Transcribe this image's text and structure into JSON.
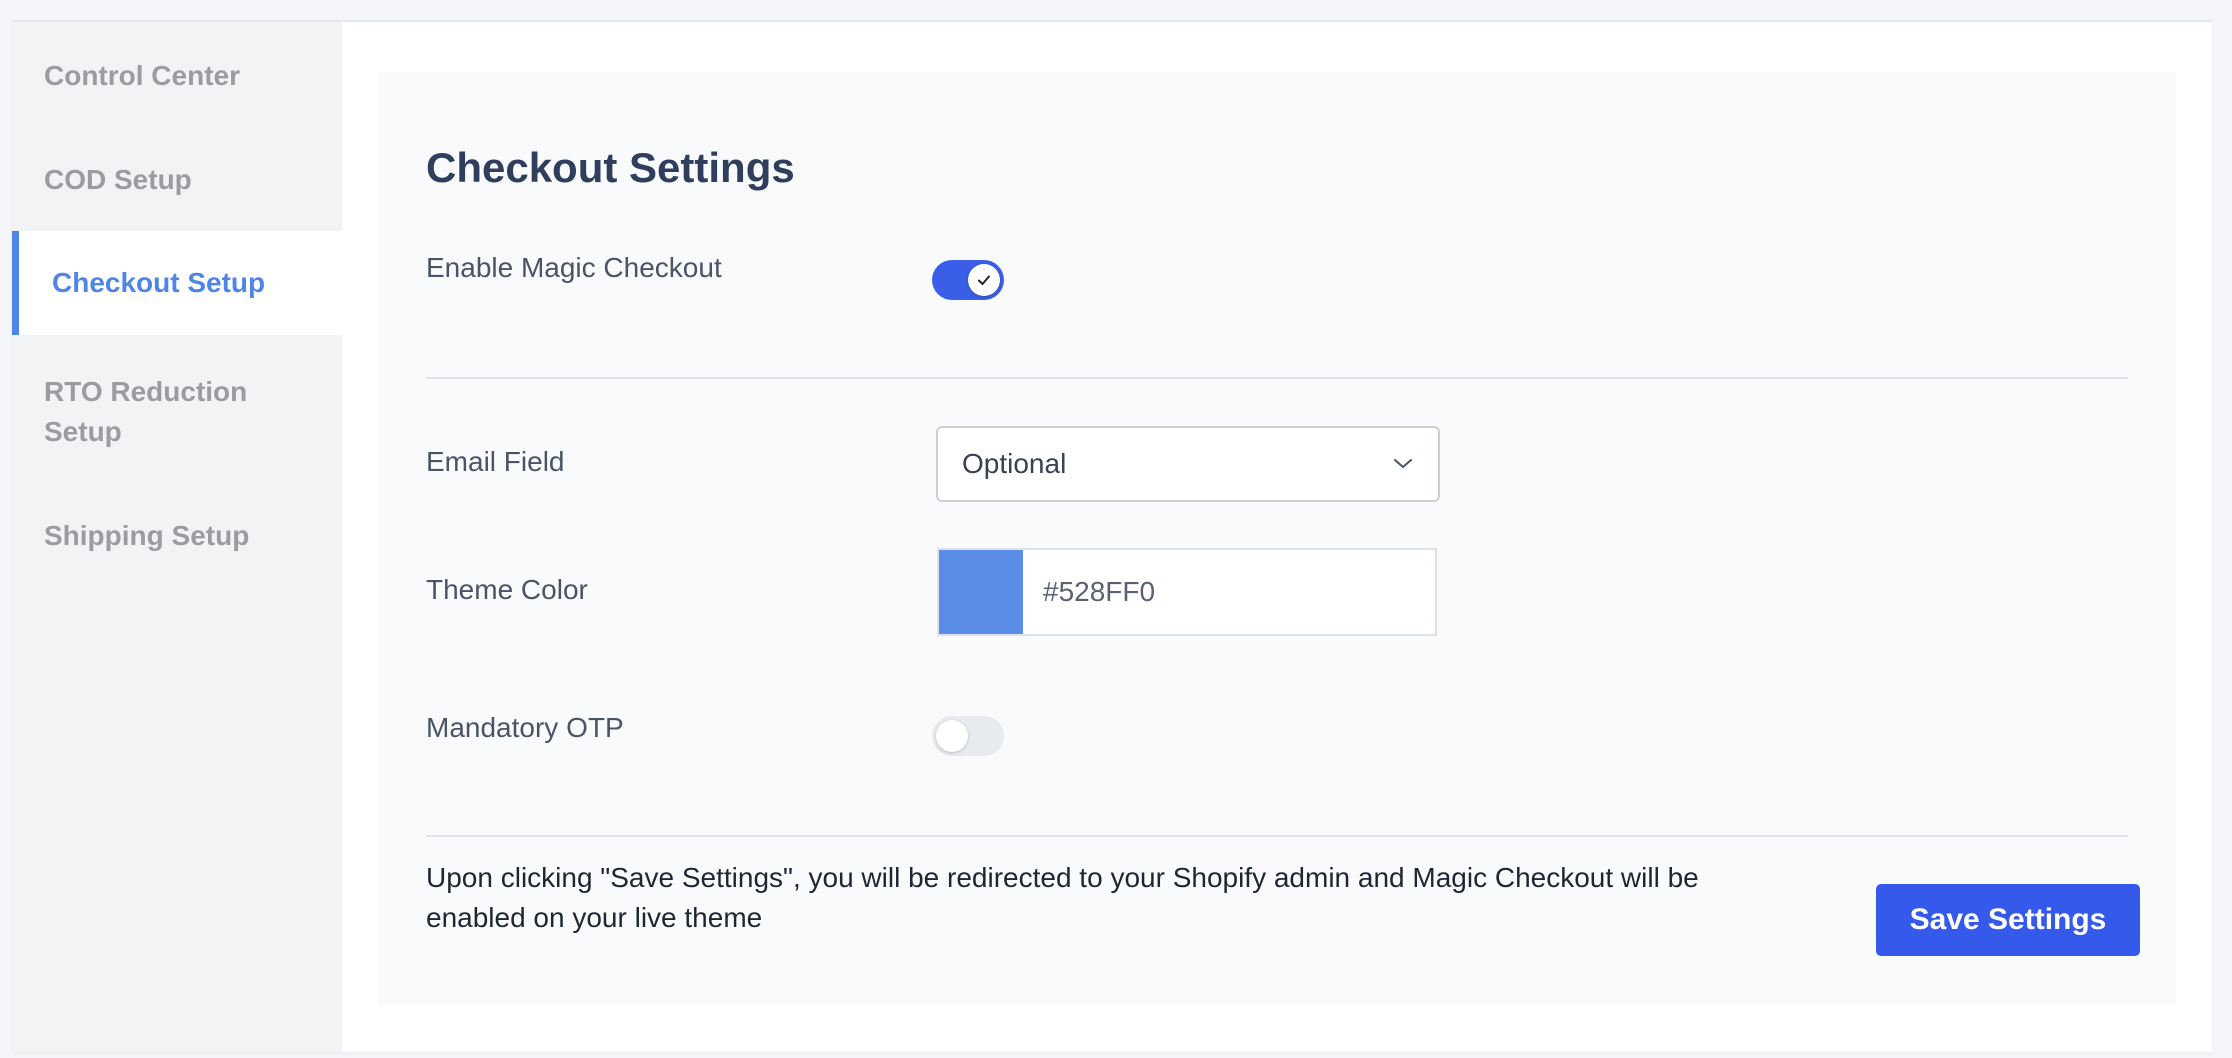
{
  "sidebar": {
    "items": [
      {
        "label": "Control Center"
      },
      {
        "label": "COD Setup"
      },
      {
        "label": "Checkout Setup"
      },
      {
        "label": "RTO Reduction Setup"
      },
      {
        "label": "Shipping Setup"
      }
    ],
    "active_index": 2
  },
  "main": {
    "title": "Checkout Settings",
    "magic_checkout": {
      "label": "Enable Magic Checkout",
      "enabled": true
    },
    "email_field": {
      "label": "Email Field",
      "value": "Optional"
    },
    "theme_color": {
      "label": "Theme Color",
      "value": "#528FF0",
      "swatch": "#5b8de8"
    },
    "mandatory_otp": {
      "label": "Mandatory OTP",
      "enabled": false
    },
    "note": "Upon clicking \"Save Settings\", you will be redirected to your Shopify admin and Magic Checkout will be enabled on your live theme",
    "save_label": "Save Settings"
  },
  "icons": {
    "toggle_check": "check-icon",
    "select_arrow": "chevron-down-icon"
  },
  "colors": {
    "accent": "#3559eb",
    "active_nav": "#4f86e6"
  }
}
